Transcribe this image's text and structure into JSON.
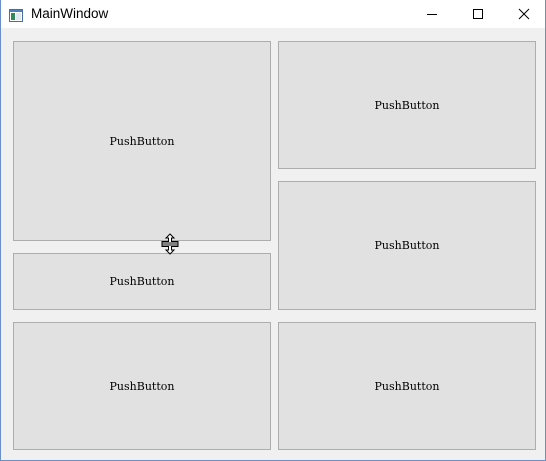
{
  "window": {
    "title": "MainWindow"
  },
  "icons": {
    "app": "app-window-icon",
    "minimize": "minimize-icon",
    "maximize": "maximize-icon",
    "close": "close-icon",
    "cursor": "vertical-resize-cursor-icon"
  },
  "buttons": {
    "top_left": "PushButton",
    "top_right": "PushButton",
    "middle_left": "PushButton",
    "middle_right": "PushButton",
    "bottom_left": "PushButton",
    "bottom_right": "PushButton"
  },
  "colors": {
    "window_border": "#6b90c9",
    "button_face": "#e1e1e1",
    "button_border": "#adadad",
    "client_background": "#f0f0f0"
  }
}
